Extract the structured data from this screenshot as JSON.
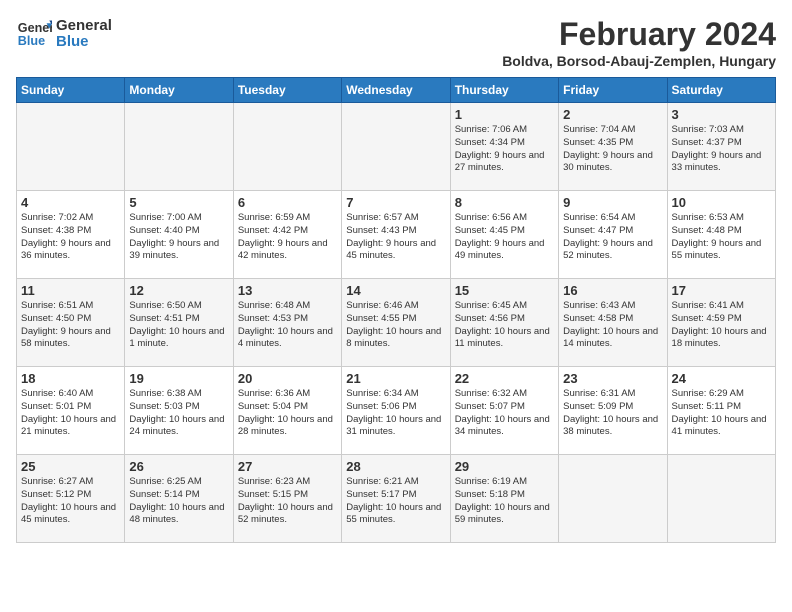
{
  "logo": {
    "line1": "General",
    "line2": "Blue"
  },
  "calendar": {
    "title": "February 2024",
    "subtitle": "Boldva, Borsod-Abauj-Zemplen, Hungary"
  },
  "weekdays": [
    "Sunday",
    "Monday",
    "Tuesday",
    "Wednesday",
    "Thursday",
    "Friday",
    "Saturday"
  ],
  "weeks": [
    [
      {
        "day": "",
        "info": ""
      },
      {
        "day": "",
        "info": ""
      },
      {
        "day": "",
        "info": ""
      },
      {
        "day": "",
        "info": ""
      },
      {
        "day": "1",
        "info": "Sunrise: 7:06 AM\nSunset: 4:34 PM\nDaylight: 9 hours and 27 minutes."
      },
      {
        "day": "2",
        "info": "Sunrise: 7:04 AM\nSunset: 4:35 PM\nDaylight: 9 hours and 30 minutes."
      },
      {
        "day": "3",
        "info": "Sunrise: 7:03 AM\nSunset: 4:37 PM\nDaylight: 9 hours and 33 minutes."
      }
    ],
    [
      {
        "day": "4",
        "info": "Sunrise: 7:02 AM\nSunset: 4:38 PM\nDaylight: 9 hours and 36 minutes."
      },
      {
        "day": "5",
        "info": "Sunrise: 7:00 AM\nSunset: 4:40 PM\nDaylight: 9 hours and 39 minutes."
      },
      {
        "day": "6",
        "info": "Sunrise: 6:59 AM\nSunset: 4:42 PM\nDaylight: 9 hours and 42 minutes."
      },
      {
        "day": "7",
        "info": "Sunrise: 6:57 AM\nSunset: 4:43 PM\nDaylight: 9 hours and 45 minutes."
      },
      {
        "day": "8",
        "info": "Sunrise: 6:56 AM\nSunset: 4:45 PM\nDaylight: 9 hours and 49 minutes."
      },
      {
        "day": "9",
        "info": "Sunrise: 6:54 AM\nSunset: 4:47 PM\nDaylight: 9 hours and 52 minutes."
      },
      {
        "day": "10",
        "info": "Sunrise: 6:53 AM\nSunset: 4:48 PM\nDaylight: 9 hours and 55 minutes."
      }
    ],
    [
      {
        "day": "11",
        "info": "Sunrise: 6:51 AM\nSunset: 4:50 PM\nDaylight: 9 hours and 58 minutes."
      },
      {
        "day": "12",
        "info": "Sunrise: 6:50 AM\nSunset: 4:51 PM\nDaylight: 10 hours and 1 minute."
      },
      {
        "day": "13",
        "info": "Sunrise: 6:48 AM\nSunset: 4:53 PM\nDaylight: 10 hours and 4 minutes."
      },
      {
        "day": "14",
        "info": "Sunrise: 6:46 AM\nSunset: 4:55 PM\nDaylight: 10 hours and 8 minutes."
      },
      {
        "day": "15",
        "info": "Sunrise: 6:45 AM\nSunset: 4:56 PM\nDaylight: 10 hours and 11 minutes."
      },
      {
        "day": "16",
        "info": "Sunrise: 6:43 AM\nSunset: 4:58 PM\nDaylight: 10 hours and 14 minutes."
      },
      {
        "day": "17",
        "info": "Sunrise: 6:41 AM\nSunset: 4:59 PM\nDaylight: 10 hours and 18 minutes."
      }
    ],
    [
      {
        "day": "18",
        "info": "Sunrise: 6:40 AM\nSunset: 5:01 PM\nDaylight: 10 hours and 21 minutes."
      },
      {
        "day": "19",
        "info": "Sunrise: 6:38 AM\nSunset: 5:03 PM\nDaylight: 10 hours and 24 minutes."
      },
      {
        "day": "20",
        "info": "Sunrise: 6:36 AM\nSunset: 5:04 PM\nDaylight: 10 hours and 28 minutes."
      },
      {
        "day": "21",
        "info": "Sunrise: 6:34 AM\nSunset: 5:06 PM\nDaylight: 10 hours and 31 minutes."
      },
      {
        "day": "22",
        "info": "Sunrise: 6:32 AM\nSunset: 5:07 PM\nDaylight: 10 hours and 34 minutes."
      },
      {
        "day": "23",
        "info": "Sunrise: 6:31 AM\nSunset: 5:09 PM\nDaylight: 10 hours and 38 minutes."
      },
      {
        "day": "24",
        "info": "Sunrise: 6:29 AM\nSunset: 5:11 PM\nDaylight: 10 hours and 41 minutes."
      }
    ],
    [
      {
        "day": "25",
        "info": "Sunrise: 6:27 AM\nSunset: 5:12 PM\nDaylight: 10 hours and 45 minutes."
      },
      {
        "day": "26",
        "info": "Sunrise: 6:25 AM\nSunset: 5:14 PM\nDaylight: 10 hours and 48 minutes."
      },
      {
        "day": "27",
        "info": "Sunrise: 6:23 AM\nSunset: 5:15 PM\nDaylight: 10 hours and 52 minutes."
      },
      {
        "day": "28",
        "info": "Sunrise: 6:21 AM\nSunset: 5:17 PM\nDaylight: 10 hours and 55 minutes."
      },
      {
        "day": "29",
        "info": "Sunrise: 6:19 AM\nSunset: 5:18 PM\nDaylight: 10 hours and 59 minutes."
      },
      {
        "day": "",
        "info": ""
      },
      {
        "day": "",
        "info": ""
      }
    ]
  ]
}
